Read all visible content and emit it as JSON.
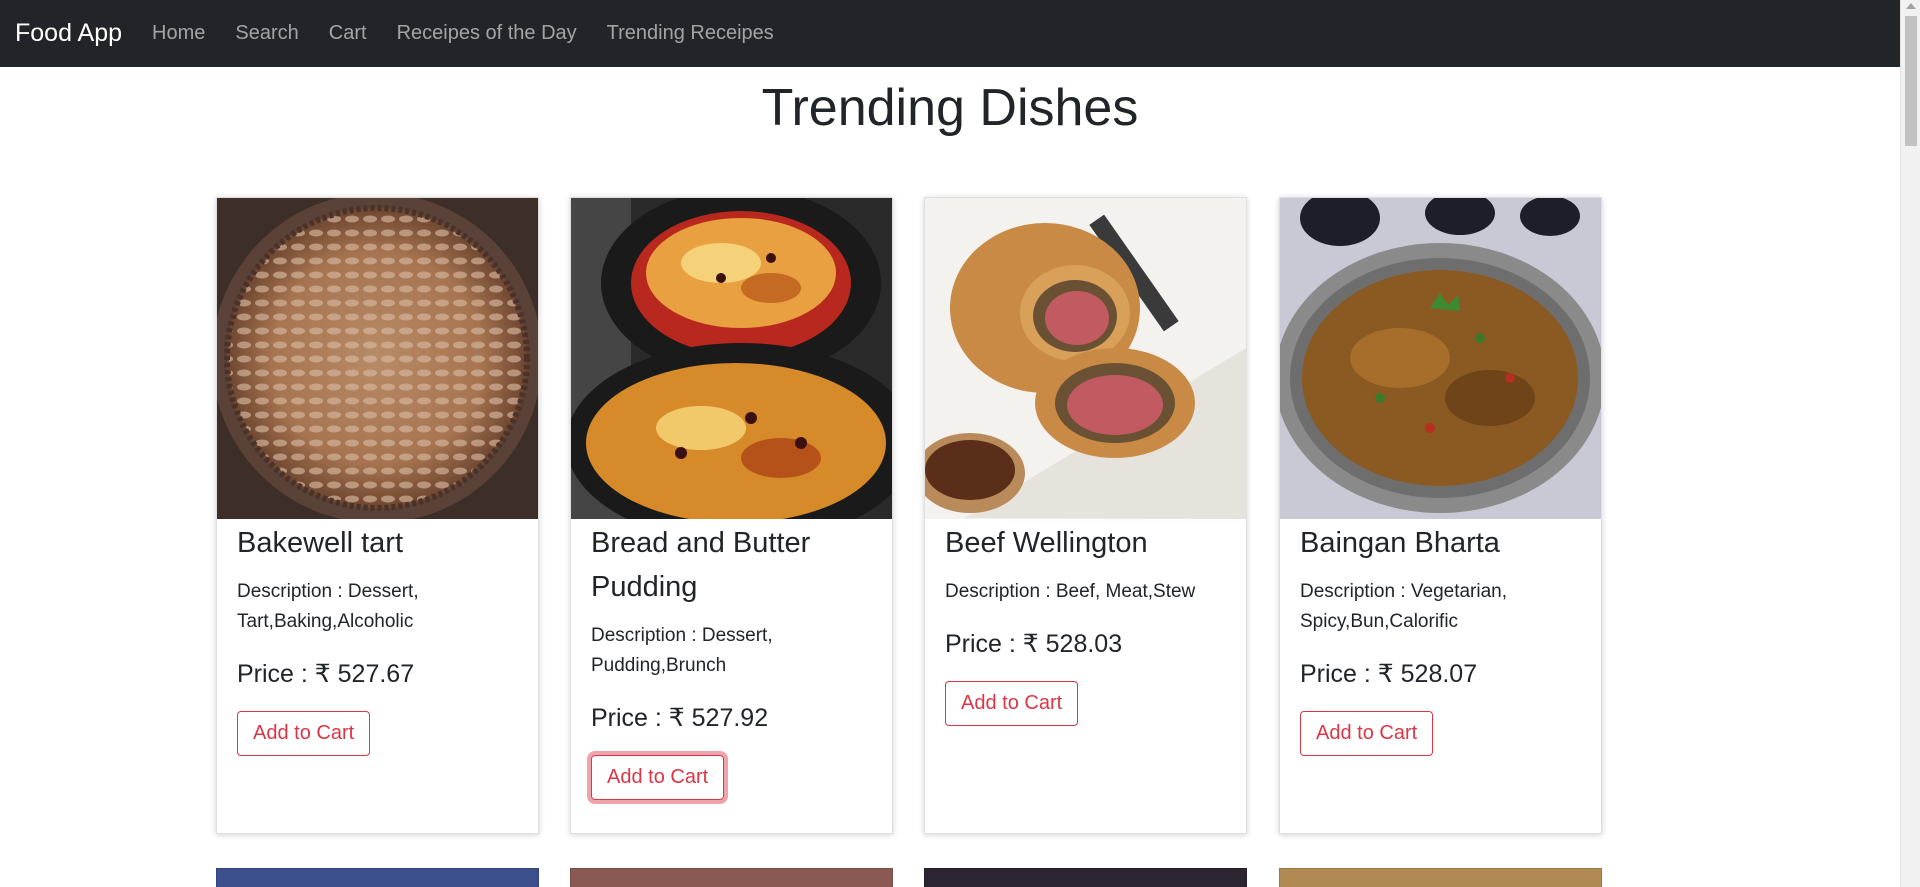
{
  "nav": {
    "brand": "Food App",
    "links": [
      "Home",
      "Search",
      "Cart",
      "Receipes of the Day",
      "Trending Receipes"
    ]
  },
  "page_title": "Trending Dishes",
  "dishes": [
    {
      "name": "Bakewell tart",
      "description": "Description : Dessert, Tart,Baking,Alcoholic",
      "price": "Price : ₹ 527.67",
      "button": "Add to Cart"
    },
    {
      "name": "Bread and Butter Pudding",
      "description": "Description : Dessert, Pudding,Brunch",
      "price": "Price : ₹ 527.92",
      "button": "Add to Cart"
    },
    {
      "name": "Beef Wellington",
      "description": "Description : Beef, Meat,Stew",
      "price": "Price : ₹ 528.03",
      "button": "Add to Cart"
    },
    {
      "name": "Baingan Bharta",
      "description": "Description : Vegetarian, Spicy,Bun,Calorific",
      "price": "Price : ₹ 528.07",
      "button": "Add to Cart"
    }
  ],
  "colors": {
    "navbar": "#212529",
    "accent": "#dc3545",
    "text": "#212529"
  }
}
